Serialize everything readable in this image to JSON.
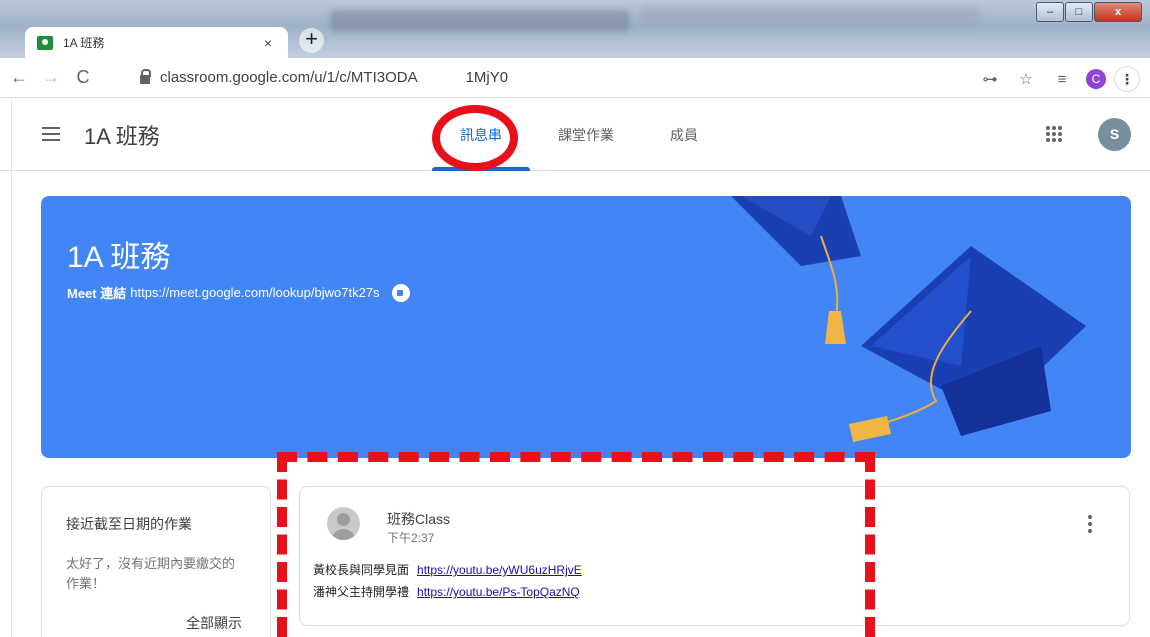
{
  "browser": {
    "tab_title": "1A 班務",
    "tab_close": "×",
    "new_tab": "+",
    "url": "classroom.google.com/u/1/c/MTI3ODA",
    "url_tail": "1MjY0",
    "profile_initial": "C",
    "window_buttons": {
      "minimize": "–",
      "maximize": "□",
      "close": "x"
    }
  },
  "header": {
    "class_title": "1A 班務",
    "tabs": [
      {
        "label": "訊息串",
        "active": true
      },
      {
        "label": "課堂作業",
        "active": false
      },
      {
        "label": "成員",
        "active": false
      }
    ],
    "avatar_initial": "S"
  },
  "banner": {
    "title": "1A 班務",
    "meet_label": "Meet 連結",
    "meet_url": "https://meet.google.com/lookup/bjwo7tk27s",
    "color": "#4285f4"
  },
  "upcoming": {
    "title": "接近截至日期的作業",
    "message": "太好了，沒有近期內要繳交的作業！",
    "view_all": "全部顯示"
  },
  "post": {
    "author": "班務Class",
    "time": "下午2:37",
    "lines": [
      {
        "text": "黃校長與同學見面",
        "link": "https://youtu.be/yWU6uzHRjvE"
      },
      {
        "text": "潘神父主持開學禮",
        "link": "https://youtu.be/Ps-TopQazNQ"
      }
    ]
  },
  "colors": {
    "accent": "#1967d2",
    "annotation": "#e8101a"
  }
}
